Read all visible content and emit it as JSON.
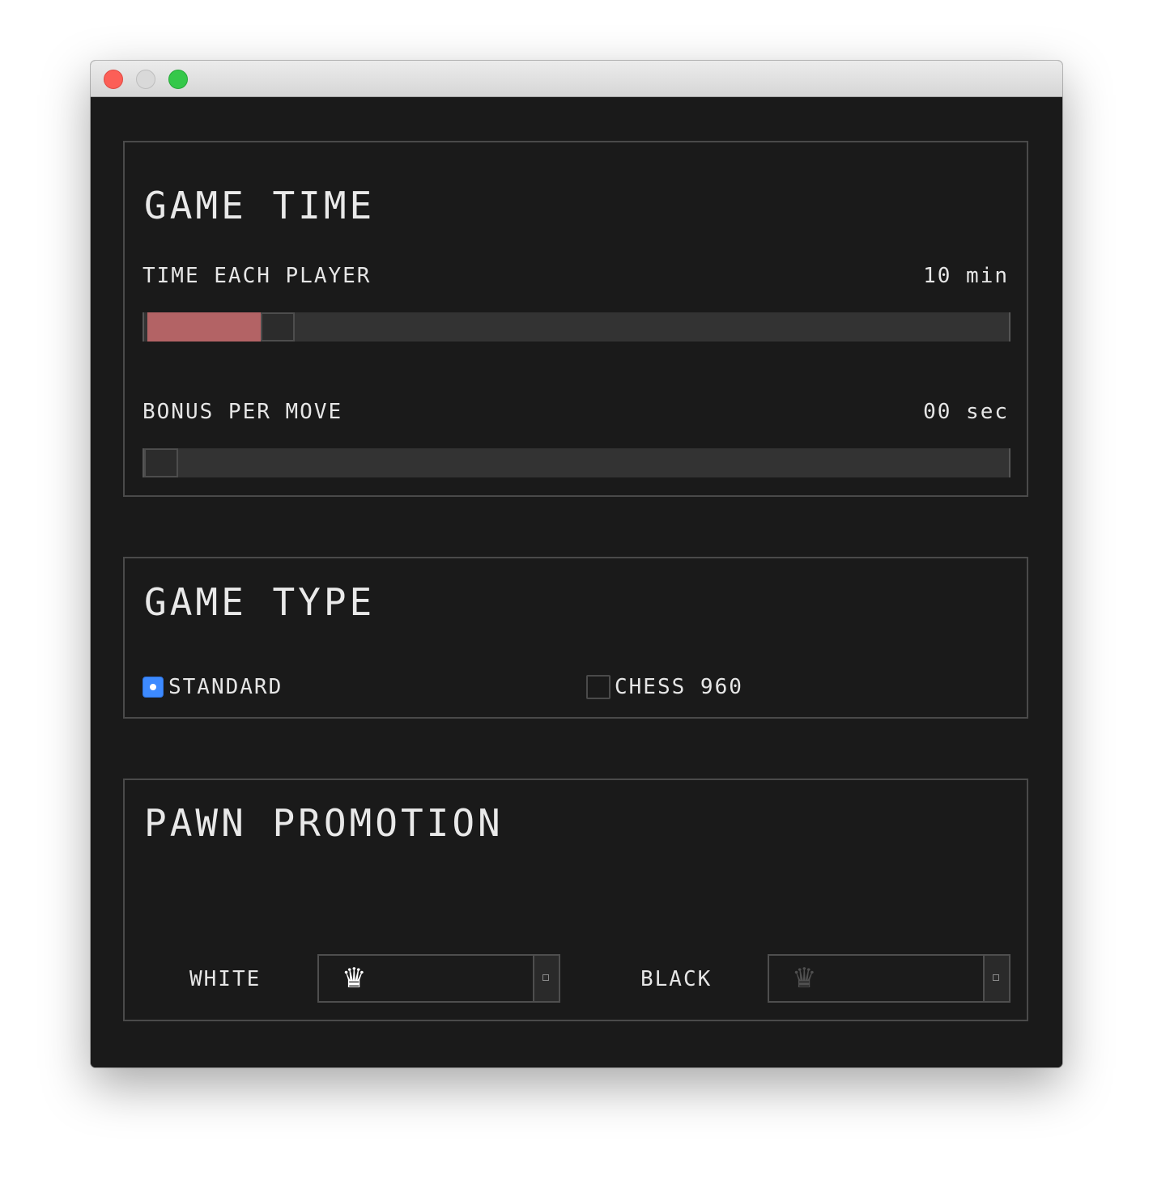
{
  "game_time": {
    "title": "GAME TIME",
    "time_each_player": {
      "label": "TIME EACH PLAYER",
      "value": "10 min",
      "fraction": 0.14
    },
    "bonus_per_move": {
      "label": "BONUS PER MOVE",
      "value": "00 sec",
      "fraction": 0.0
    }
  },
  "game_type": {
    "title": "GAME TYPE",
    "options": [
      {
        "label": "STANDARD",
        "selected": true
      },
      {
        "label": "CHESS 960",
        "selected": false
      }
    ]
  },
  "pawn_promotion": {
    "title": "PAWN PROMOTION",
    "white": {
      "label": "WHITE",
      "piece_icon": "white-queen-icon",
      "glyph": "♛"
    },
    "black": {
      "label": "BLACK",
      "piece_icon": "black-queen-icon",
      "glyph": "♛"
    }
  },
  "colors": {
    "background": "#1a1a1a",
    "accent_fill": "#b36365",
    "radio_selected": "#3d8aff",
    "border": "#4a4a4a"
  }
}
